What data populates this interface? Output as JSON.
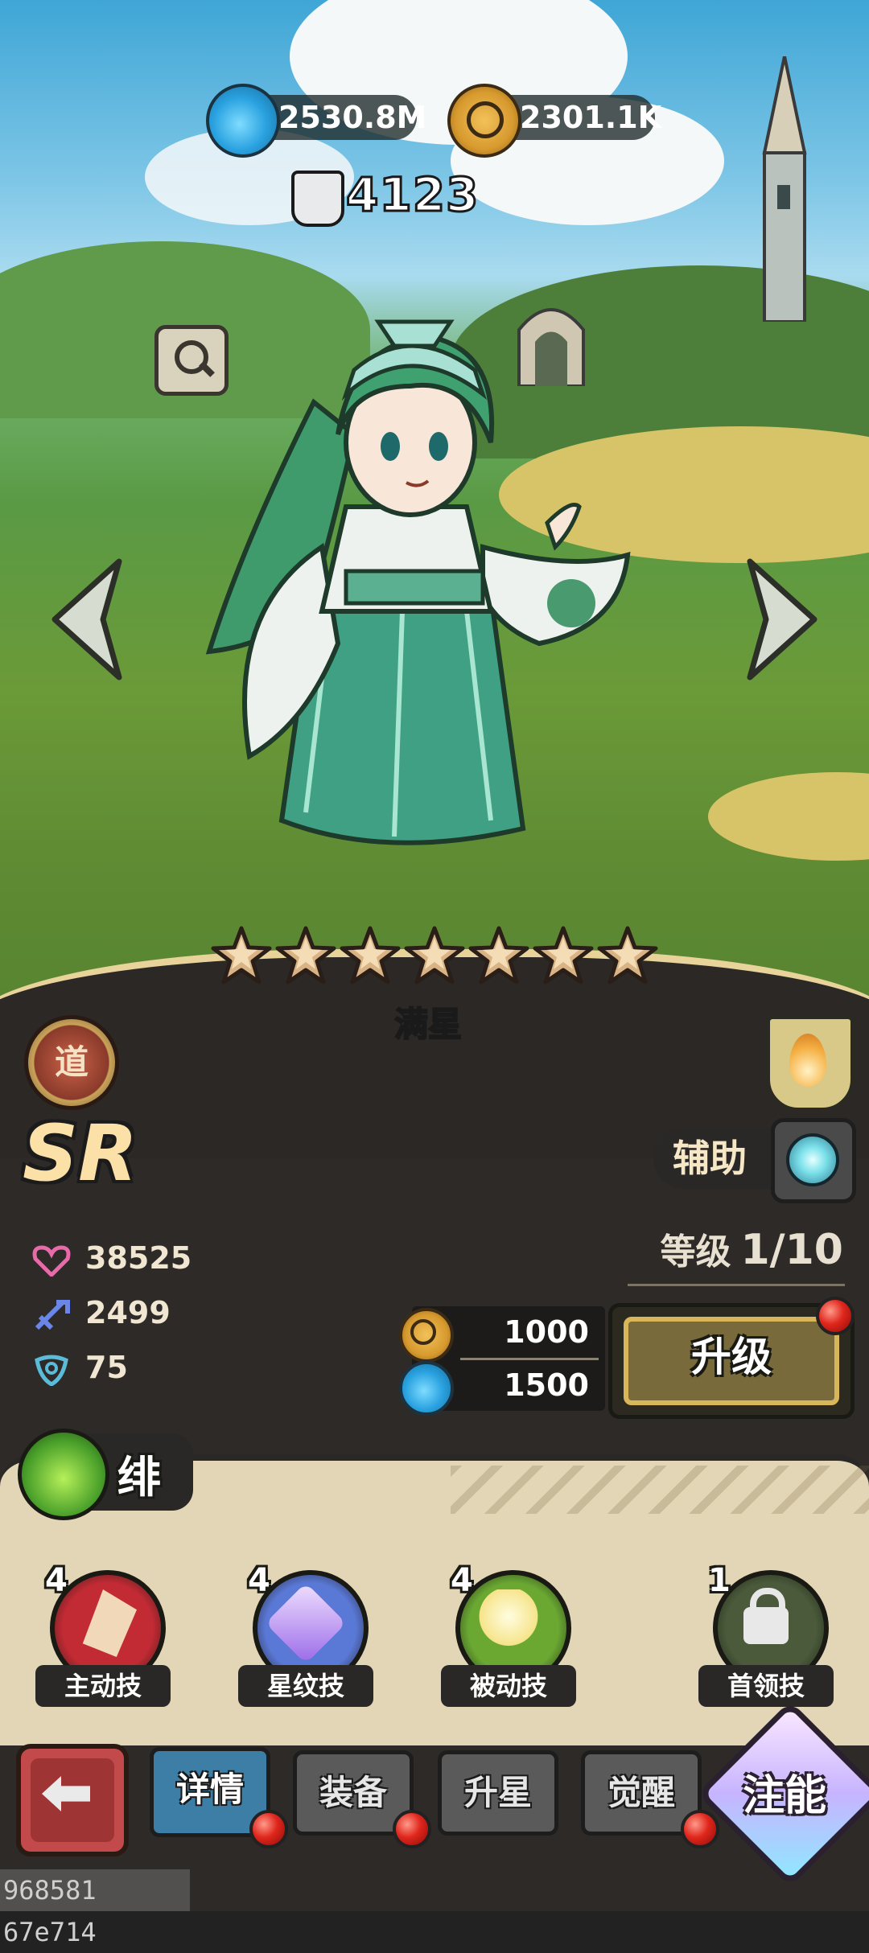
{
  "resources": {
    "potion": "2530.8M",
    "coin": "2301.1K"
  },
  "combat_power": "4123",
  "hero": {
    "star_label": "满星",
    "stars": 7,
    "faction": "道",
    "rarity": "SR",
    "role": "辅助",
    "name": "绯"
  },
  "stats": {
    "level_label": "等级",
    "level_value": "1/10",
    "hp": "38525",
    "attack": "2499",
    "defense": "75"
  },
  "upgrade": {
    "coin_cost": "1000",
    "potion_cost": "1500",
    "button_label": "升级"
  },
  "skills": [
    {
      "level": "4",
      "label": "主动技",
      "color": "#c22a34"
    },
    {
      "level": "4",
      "label": "星纹技",
      "color": "#5a78d6"
    },
    {
      "level": "4",
      "label": "被动技",
      "color": "#6aa832"
    },
    {
      "level": "1",
      "label": "首领技",
      "color": "#4a5a3a"
    }
  ],
  "tabs": [
    {
      "label": "详情"
    },
    {
      "label": "装备"
    },
    {
      "label": "升星"
    },
    {
      "label": "觉醒"
    }
  ],
  "inject_label": "注能",
  "footer_id": "968581 67e714"
}
